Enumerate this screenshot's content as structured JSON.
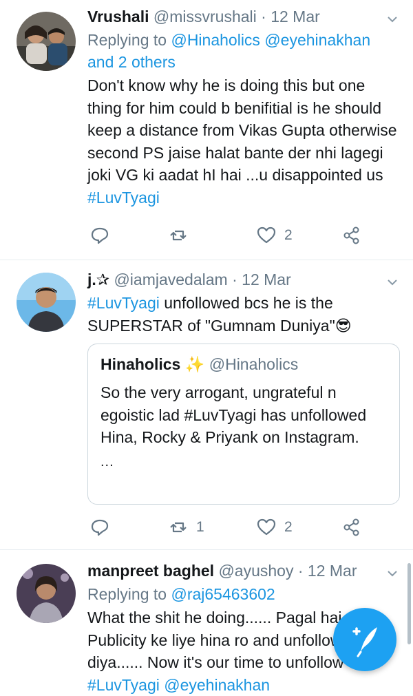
{
  "tweets": [
    {
      "name": "Vrushali",
      "handle": "@missvrushali",
      "time": "12 Mar",
      "reply_prefix": "Replying to",
      "reply_to_1": "@Hinaholics",
      "reply_to_2": "@eyehinakhan",
      "reply_and": "and 2 others",
      "text": "Don't know why he is doing this but one thing for him could b benifitial is he should keep  a distance from Vikas Gupta otherwise second PS jaise halat bante der nhi lagegi joki VG ki aadat hI hai ...u disappointed us ",
      "hashtag": "#LuvTyagi",
      "likes": "2"
    },
    {
      "name": "j.✰",
      "handle": "@iamjavedalam",
      "time": "12 Mar",
      "hashtag": "#LuvTyagi",
      "text": " unfollowed bcs he is the SUPERSTAR of \"Gumnam Duniya\"😎",
      "quote": {
        "name": "Hinaholics",
        "sparkle": "✨",
        "handle": "@Hinaholics",
        "text": "So the very arrogant, ungrateful n egoistic lad #LuvTyagi has unfollowed Hina, Rocky & Priyank on Instagram.",
        "more": "..."
      },
      "retweets": "1",
      "likes": "2"
    },
    {
      "name": "manpreet baghel",
      "handle": "@ayushoy",
      "time": "12 Mar",
      "reply_prefix": "Replying to",
      "reply_to_1": "@raj65463602",
      "text": "What the shit he doing...... Pagal hai vo... Publicity ke liye hina ro and unfollow kr diya...... Now it's our time to unfollow ",
      "hashtag": "#LuvTyagi",
      "text_end": " @eyehinakhan"
    }
  ],
  "separator": "·",
  "icons": {
    "reply": "reply-icon",
    "retweet": "retweet-icon",
    "like": "heart-icon",
    "share": "share-icon",
    "compose": "compose-tweet-icon"
  },
  "colors": {
    "accent": "#1da1f2",
    "link": "#1b95e0",
    "muted": "#657786"
  }
}
